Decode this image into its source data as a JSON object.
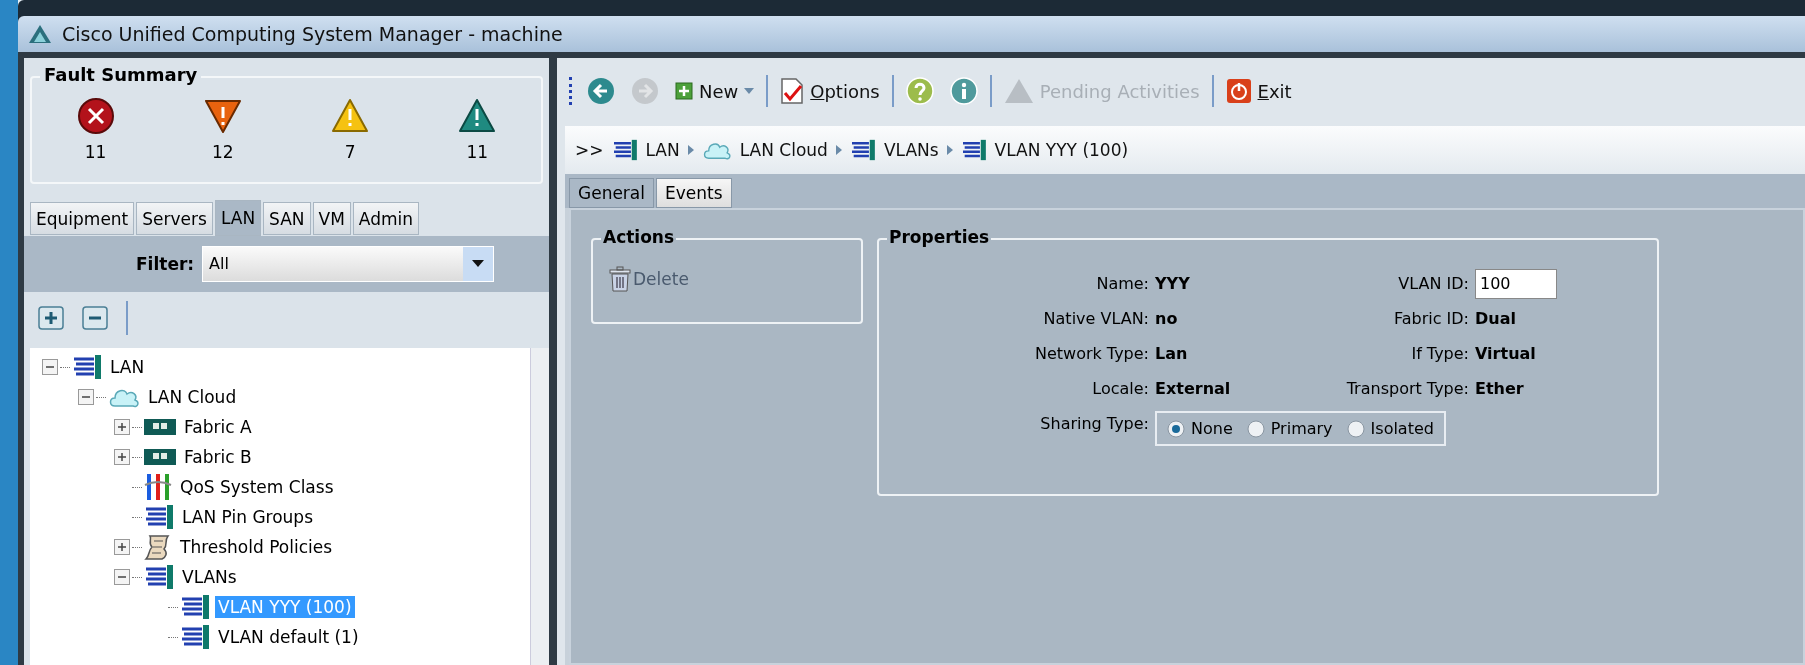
{
  "window": {
    "title": "Cisco Unified Computing System Manager - machine"
  },
  "fault_summary": {
    "title": "Fault Summary",
    "faults": [
      {
        "kind": "critical",
        "count": "11"
      },
      {
        "kind": "major",
        "count": "12"
      },
      {
        "kind": "minor",
        "count": "7"
      },
      {
        "kind": "warning",
        "count": "11"
      }
    ]
  },
  "nav_tabs": [
    {
      "label": "Equipment",
      "selected": false
    },
    {
      "label": "Servers",
      "selected": false
    },
    {
      "label": "LAN",
      "selected": true
    },
    {
      "label": "SAN",
      "selected": false
    },
    {
      "label": "VM",
      "selected": false
    },
    {
      "label": "Admin",
      "selected": false
    }
  ],
  "filter": {
    "label": "Filter:",
    "value": "All"
  },
  "tree": [
    {
      "label": "LAN",
      "kind": "list",
      "expanded": true,
      "selected": false,
      "children": [
        {
          "label": "LAN Cloud",
          "kind": "cloud",
          "expanded": true,
          "selected": false,
          "children": [
            {
              "label": "Fabric A",
              "kind": "fabric",
              "expanded": false,
              "selected": false
            },
            {
              "label": "Fabric B",
              "kind": "fabric",
              "expanded": false,
              "selected": false
            },
            {
              "label": "QoS System Class",
              "kind": "qos",
              "selected": false
            },
            {
              "label": "LAN Pin Groups",
              "kind": "list",
              "selected": false
            },
            {
              "label": "Threshold Policies",
              "kind": "scroll",
              "expanded": false,
              "selected": false
            },
            {
              "label": "VLANs",
              "kind": "list",
              "expanded": true,
              "selected": false,
              "children": [
                {
                  "label": "VLAN YYY (100)",
                  "kind": "list",
                  "selected": true
                },
                {
                  "label": "VLAN default (1)",
                  "kind": "list",
                  "selected": false
                }
              ]
            }
          ]
        }
      ]
    }
  ],
  "toolbar": [
    {
      "kind": "back",
      "disabled": false
    },
    {
      "kind": "forward",
      "disabled": true
    },
    {
      "kind": "new",
      "label": "New",
      "disabled": false
    },
    {
      "kind": "options",
      "label": "Options",
      "disabled": false
    },
    {
      "kind": "help",
      "disabled": false
    },
    {
      "kind": "info",
      "disabled": false
    },
    {
      "kind": "pending",
      "label": "Pending Activities",
      "disabled": true
    },
    {
      "kind": "exit",
      "label": "Exit",
      "disabled": false
    }
  ],
  "breadcrumb": {
    "prefix": ">>",
    "items": [
      {
        "label": "LAN",
        "kind": "list"
      },
      {
        "label": "LAN Cloud",
        "kind": "cloud"
      },
      {
        "label": "VLANs",
        "kind": "list"
      },
      {
        "label": "VLAN YYY (100)",
        "kind": "list"
      }
    ]
  },
  "content_tabs": [
    {
      "label": "General",
      "selected": true
    },
    {
      "label": "Events",
      "selected": false
    }
  ],
  "actions": {
    "title": "Actions",
    "items": [
      {
        "label": "Delete",
        "disabled": true
      }
    ]
  },
  "properties": {
    "title": "Properties",
    "left": [
      {
        "label": "Name:",
        "value": "YYY"
      },
      {
        "label": "Native VLAN:",
        "value": "no"
      },
      {
        "label": "Network Type:",
        "value": "Lan"
      },
      {
        "label": "Locale:",
        "value": "External"
      }
    ],
    "right": [
      {
        "label": "VLAN ID:",
        "value": "100",
        "kind": "input"
      },
      {
        "label": "Fabric ID:",
        "value": "Dual"
      },
      {
        "label": "If Type:",
        "value": "Virtual"
      },
      {
        "label": "Transport Type:",
        "value": "Ether"
      }
    ],
    "sharing": {
      "label": "Sharing Type:",
      "options": [
        {
          "label": "None",
          "selected": true
        },
        {
          "label": "Primary",
          "selected": false
        },
        {
          "label": "Isolated",
          "selected": false
        }
      ]
    }
  }
}
